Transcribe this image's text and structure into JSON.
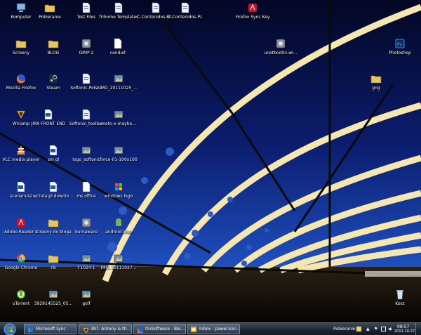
{
  "desktop_icons": [
    {
      "label": "Komputer",
      "kind": "computer"
    },
    {
      "label": "Pobieranie",
      "kind": "folder"
    },
    {
      "label": "Test Files",
      "kind": "file"
    },
    {
      "label": "Trihome Templates",
      "kind": "file"
    },
    {
      "label": "C-Contenidos-Bl...",
      "kind": "file"
    },
    {
      "label": "Z-Contenidos-PL",
      "kind": "file"
    },
    {
      "label": "Firefox Sync Key",
      "kind": "pdf"
    },
    {
      "label": "Screeny",
      "kind": "folder"
    },
    {
      "label": "BLOG",
      "kind": "folder"
    },
    {
      "label": "GIMP 2",
      "kind": "app"
    },
    {
      "label": "conduit",
      "kind": "doc"
    },
    {
      "label": "unetbootin-wi...",
      "kind": "app"
    },
    {
      "label": "Photoshop",
      "kind": "photoshop"
    },
    {
      "label": "Mozilla Firefox",
      "kind": "firefox"
    },
    {
      "label": "Steam",
      "kind": "steam"
    },
    {
      "label": "Softonic-Polska",
      "kind": "file"
    },
    {
      "label": "IMG_20111025_...",
      "kind": "image"
    },
    {
      "label": "gng",
      "kind": "folder"
    },
    {
      "label": "Winamp",
      "kind": "winamp"
    },
    {
      "label": "JIRA FRONT END",
      "kind": "word"
    },
    {
      "label": "Softonic_toolbar",
      "kind": "file"
    },
    {
      "label": "moto-x-mayhe...",
      "kind": "image"
    },
    {
      "label": "VLC media player",
      "kind": "vlc"
    },
    {
      "label": "sm ql",
      "kind": "word"
    },
    {
      "label": "logo_softonic",
      "kind": "image"
    },
    {
      "label": "force-01-100x100",
      "kind": "image"
    },
    {
      "label": "scenariusz",
      "kind": "word"
    },
    {
      "label": "wrzuta.pl download",
      "kind": "word"
    },
    {
      "label": "ms office",
      "kind": "doc"
    },
    {
      "label": "windows logo",
      "kind": "windows"
    },
    {
      "label": "Adobe Reader X",
      "kind": "pdf"
    },
    {
      "label": "screeny do bloga",
      "kind": "folder"
    },
    {
      "label": "burnaware",
      "kind": "app"
    },
    {
      "label": "android logo",
      "kind": "android"
    },
    {
      "label": "Google Chrome",
      "kind": "chrome"
    },
    {
      "label": "nb",
      "kind": "folder"
    },
    {
      "label": "f-1024-1",
      "kind": "image"
    },
    {
      "label": "IMG_20111027...",
      "kind": "image"
    },
    {
      "label": "uTorrent",
      "kind": "utorrent"
    },
    {
      "label": "3929145525_05...",
      "kind": "image"
    },
    {
      "label": "golf",
      "kind": "image"
    },
    {
      "label": "Kosz",
      "kind": "recycle"
    }
  ],
  "taskbar": {
    "start_label": "Start",
    "tasks": [
      {
        "label": "Microsoft Lync",
        "kind": "lync"
      },
      {
        "label": "387. Antony & th...",
        "kind": "winamp"
      },
      {
        "label": "OnSoftware - Blo...",
        "kind": "firefox"
      },
      {
        "label": "Inbox - pawel.kan...",
        "kind": "outlook"
      }
    ],
    "tray": {
      "label": "Pobieranie",
      "time": "08:57",
      "date": "2011-10-27"
    }
  },
  "colors": {
    "sky_top": "#04082a",
    "sky_bottom": "#1d4bb8",
    "bridge_light": "#f6e6b0",
    "taskbar": "#1b2531"
  }
}
